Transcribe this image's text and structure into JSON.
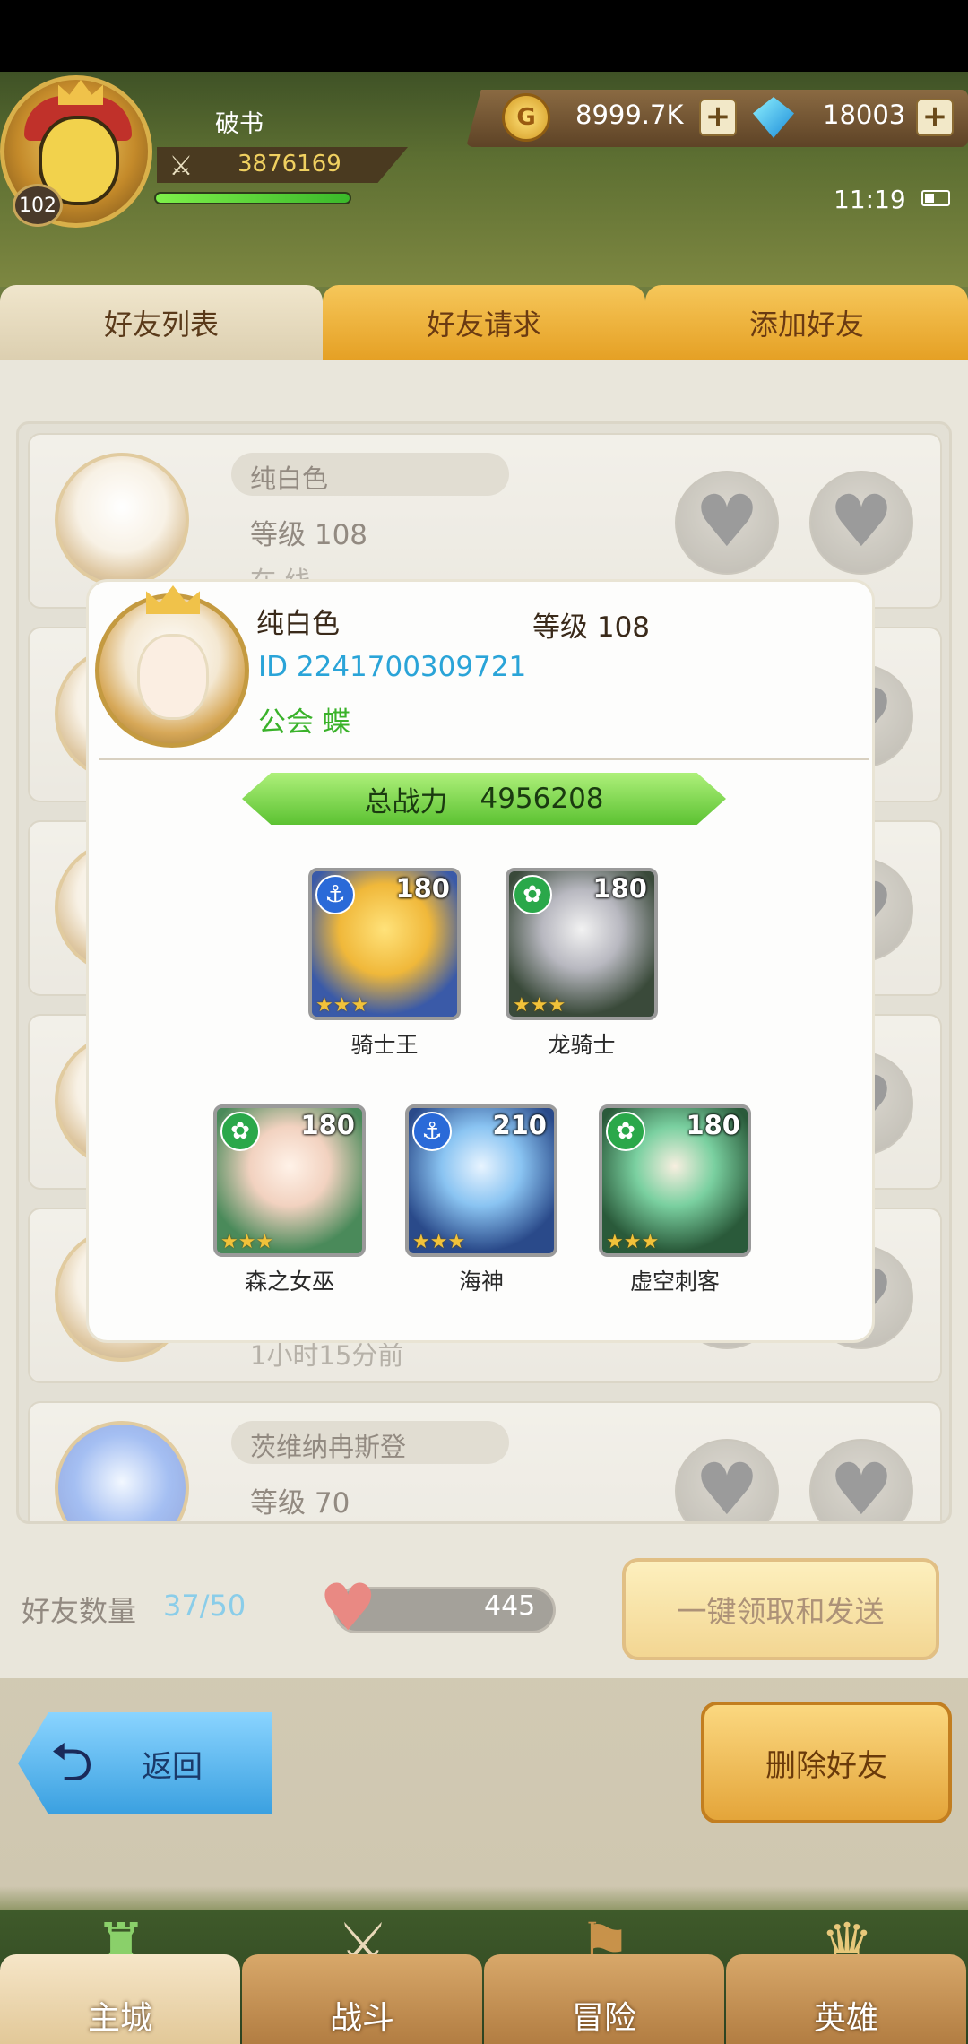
{
  "player": {
    "name": "破书",
    "level": "102",
    "power": "3876169"
  },
  "currency": {
    "gold": "8999.7K",
    "gems": "18003"
  },
  "status": {
    "time": "11:19"
  },
  "tabs": [
    "好友列表",
    "好友请求",
    "添加好友"
  ],
  "friends": [
    {
      "name": "纯白色",
      "level": "等级 108",
      "status": "在 线"
    },
    {
      "name": "",
      "level": "",
      "status": ""
    },
    {
      "name": "",
      "level": "",
      "status": ""
    },
    {
      "name": "",
      "level": "",
      "status": ""
    },
    {
      "name": "",
      "level": "",
      "status": "1小时15分前"
    },
    {
      "name": "茨维纳冉斯登",
      "level": "等级 70",
      "status": ""
    }
  ],
  "detail": {
    "name": "纯白色",
    "level": "等级 108",
    "id": "ID 2241700309721",
    "guild": "公会 蝶",
    "power_label": "总战力",
    "power_value": "4956208",
    "heroes": [
      {
        "name": "骑士王",
        "level": "180",
        "class_icon": "anchor-icon",
        "stars": "★★★"
      },
      {
        "name": "龙骑士",
        "level": "180",
        "class_icon": "paw-icon",
        "stars": "★★★"
      },
      {
        "name": "森之女巫",
        "level": "180",
        "class_icon": "paw-icon",
        "stars": "★★★"
      },
      {
        "name": "海神",
        "level": "210",
        "class_icon": "anchor-icon",
        "stars": "★★★"
      },
      {
        "name": "虚空刺客",
        "level": "180",
        "class_icon": "paw-icon",
        "stars": "★★★"
      }
    ]
  },
  "footer": {
    "friend_count_label": "好友数量",
    "friend_count": "37/50",
    "hearts": "445",
    "claim_button": "一键领取和发送",
    "back_button": "返回",
    "delete_button": "删除好友"
  },
  "nav": [
    "主城",
    "战斗",
    "冒险",
    "英雄"
  ],
  "colors": {
    "accent_blue": "#2aa4d8",
    "accent_green": "#3ab22a",
    "gold_button": "#e9b53a"
  }
}
